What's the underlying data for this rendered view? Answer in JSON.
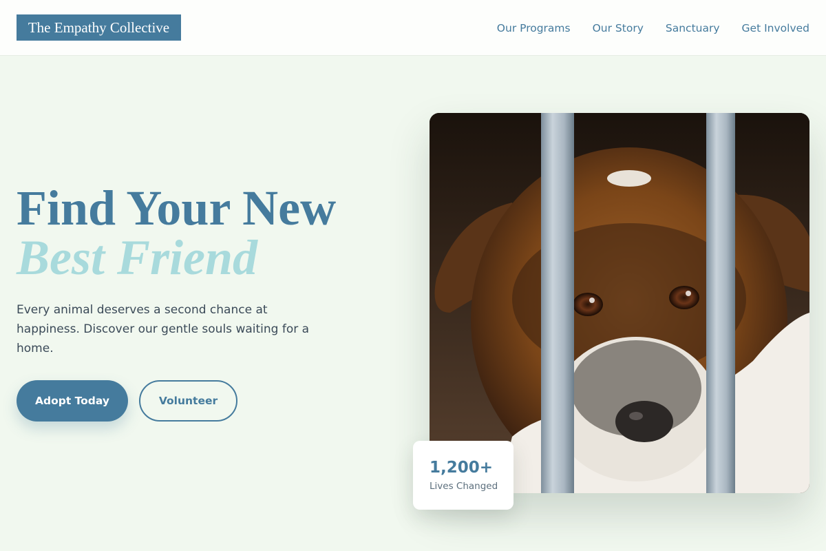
{
  "brand": {
    "name": "The Empathy Collective",
    "primary_color": "#457b9d",
    "accent_color": "#a8dadc",
    "background_color": "#f1f8ef"
  },
  "nav": {
    "items": [
      {
        "label": "Our Programs"
      },
      {
        "label": "Our Story"
      },
      {
        "label": "Sanctuary"
      },
      {
        "label": "Get Involved"
      }
    ]
  },
  "hero": {
    "title_line1": "Find Your New",
    "title_line2": "Best Friend",
    "description": "Every animal deserves a second chance at happiness. Discover our gentle souls waiting for a home.",
    "primary_button": "Adopt Today",
    "secondary_button": "Volunteer",
    "image_subject": "dog-behind-bars-photo"
  },
  "stat": {
    "value": "1,200+",
    "label": "Lives Changed"
  }
}
